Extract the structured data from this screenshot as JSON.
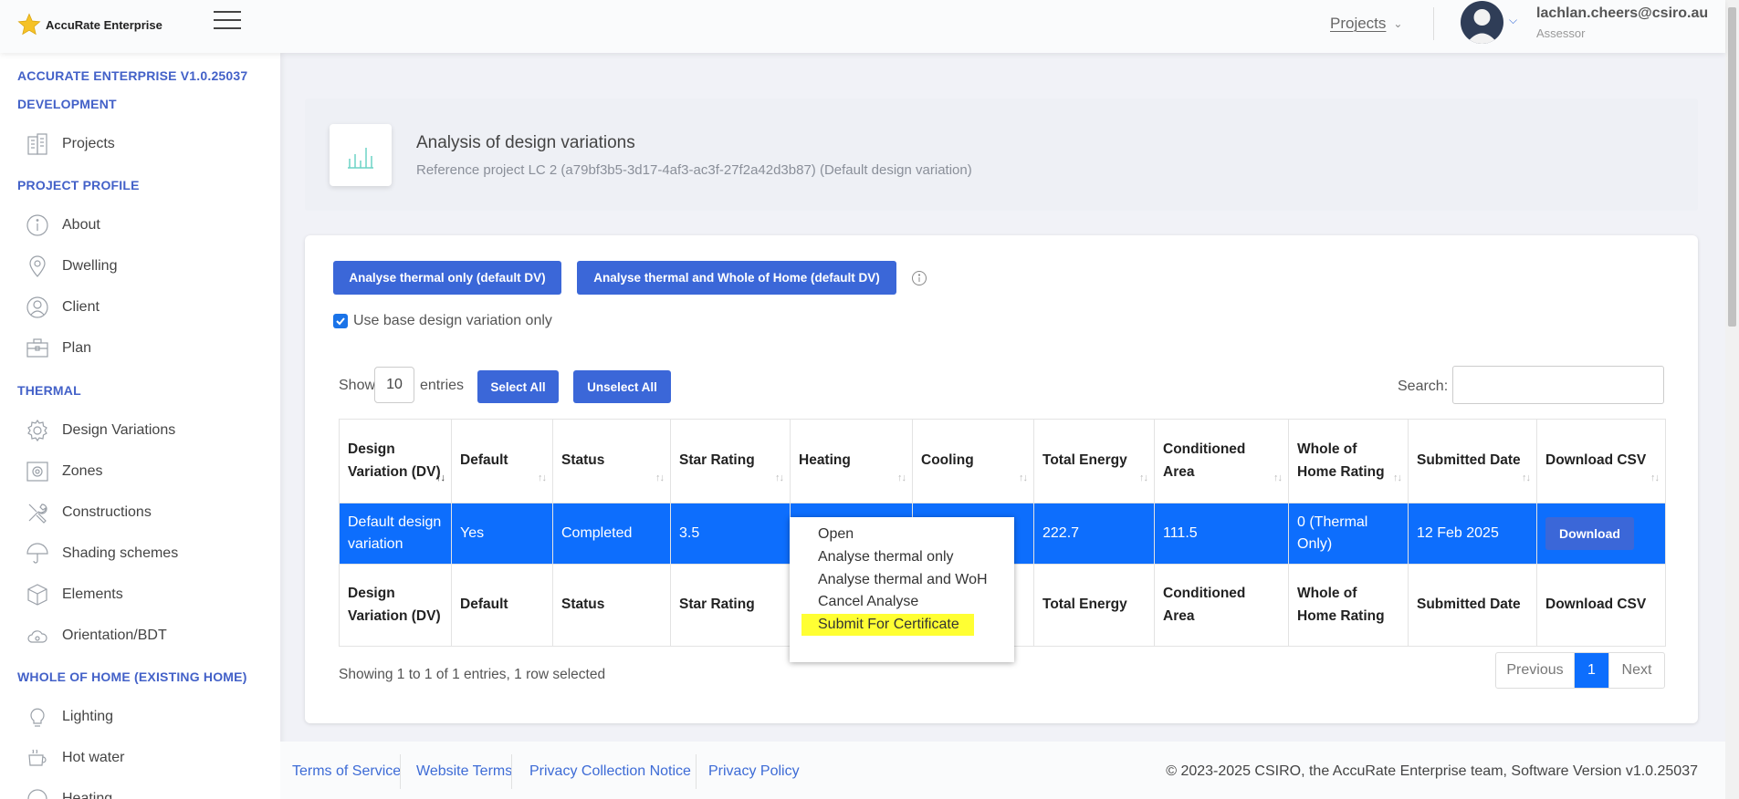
{
  "app": {
    "brand": "AccuRate Enterprise",
    "nav_projects": "Projects",
    "user_email": "lachlan.cheers@csiro.au",
    "user_role": "Assessor"
  },
  "sidebar": {
    "version_title": "ACCURATE ENTERPRISE V1.0.25037",
    "sections": {
      "development": "DEVELOPMENT",
      "project_profile": "PROJECT PROFILE",
      "thermal": "THERMAL",
      "whole_of_home": "WHOLE OF HOME (EXISTING HOME)"
    },
    "items": {
      "projects": "Projects",
      "about": "About",
      "dwelling": "Dwelling",
      "client": "Client",
      "plan": "Plan",
      "design_variations": "Design Variations",
      "zones": "Zones",
      "constructions": "Constructions",
      "shading_schemes": "Shading schemes",
      "elements": "Elements",
      "orientation": "Orientation/BDT",
      "lighting": "Lighting",
      "hot_water": "Hot water",
      "heating": "Heating"
    }
  },
  "page_header": {
    "title": "Analysis of design variations",
    "subtitle": "Reference project LC 2 (a79bf3b5-3d17-4af3-ac3f-27f2a42d3b87) (Default design variation)"
  },
  "actions": {
    "analyse_thermal": "Analyse thermal only (default DV)",
    "analyse_thermal_woh": "Analyse thermal and Whole of Home (default DV)",
    "use_base_label": "Use base design variation only",
    "use_base_checked": true
  },
  "table_controls": {
    "show": "Show",
    "length": "10",
    "entries": "entries",
    "select_all": "Select All",
    "unselect_all": "Unselect All",
    "search_label": "Search:"
  },
  "table": {
    "headers": [
      "Design Variation (DV)",
      "Default",
      "Status",
      "Star Rating",
      "Heating",
      "Cooling",
      "Total Energy",
      "Conditioned Area",
      "Whole of Home Rating",
      "Submitted Date",
      "Download CSV"
    ],
    "row": {
      "dv": "Default design variation",
      "default": "Yes",
      "status": "Completed",
      "star": "3.5",
      "total_energy": "222.7",
      "area": "111.5",
      "woh": "0 (Thermal Only)",
      "submitted": "12 Feb 2025",
      "download": "Download"
    },
    "footers": [
      "Design Variation (DV)",
      "Default",
      "Status",
      "Star Rating",
      "",
      "",
      "Total Energy",
      "Conditioned Area",
      "Whole of Home Rating",
      "Submitted Date",
      "Download CSV"
    ],
    "info": "Showing 1 to 1 of 1 entries, 1 row selected"
  },
  "pagination": {
    "previous": "Previous",
    "page": "1",
    "next": "Next"
  },
  "context_menu": {
    "items": [
      "Open",
      "Analyse thermal only",
      "Analyse thermal and WoH",
      "Cancel Analyse",
      "Submit For Certificate"
    ],
    "highlighted": "Submit For Certificate",
    "highlight_color": "#ffff33"
  },
  "footer": {
    "links": [
      "Terms of Service",
      "Website Terms",
      "Privacy Collection Notice",
      "Privacy Policy"
    ],
    "copyright": "© 2023-2025 CSIRO, the AccuRate Enterprise team, Software Version v1.0.25037"
  },
  "colors": {
    "primary": "#3b67d8",
    "selected_row": "#0d6efd",
    "section_heading": "#4361c8"
  }
}
